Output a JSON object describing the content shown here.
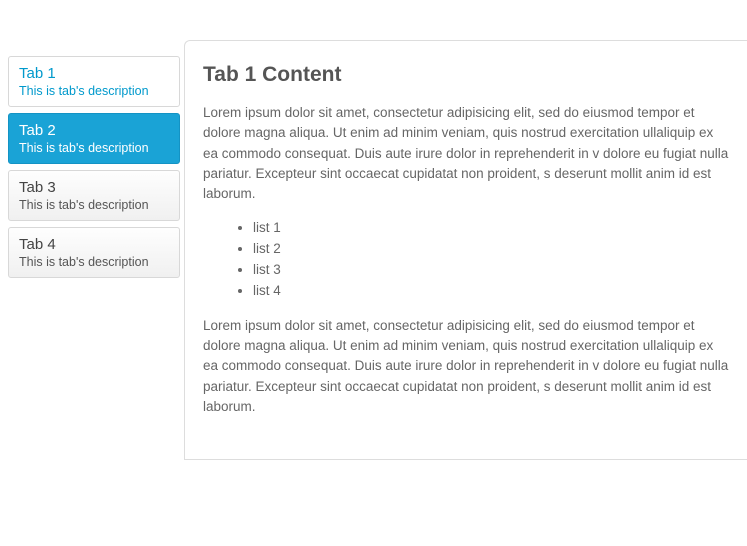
{
  "tabs": [
    {
      "title": "Tab 1",
      "desc": "This is tab's description",
      "state": "hovered"
    },
    {
      "title": "Tab 2",
      "desc": "This is tab's description",
      "state": "active"
    },
    {
      "title": "Tab 3",
      "desc": "This is tab's description",
      "state": "normal"
    },
    {
      "title": "Tab 4",
      "desc": "This is tab's description",
      "state": "normal"
    }
  ],
  "content": {
    "heading": "Tab 1 Content",
    "para1": "Lorem ipsum dolor sit amet, consectetur adipisicing elit, sed do eiusmod tempor et dolore magna aliqua. Ut enim ad minim veniam, quis nostrud exercitation ullaliquip ex ea commodo consequat. Duis aute irure dolor in reprehenderit in v dolore eu fugiat nulla pariatur. Excepteur sint occaecat cupidatat non proident, s deserunt mollit anim id est laborum.",
    "list": [
      "list 1",
      "list 2",
      "list 3",
      "list 4"
    ],
    "para2": "Lorem ipsum dolor sit amet, consectetur adipisicing elit, sed do eiusmod tempor et dolore magna aliqua. Ut enim ad minim veniam, quis nostrud exercitation ullaliquip ex ea commodo consequat. Duis aute irure dolor in reprehenderit in v dolore eu fugiat nulla pariatur. Excepteur sint occaecat cupidatat non proident, s deserunt mollit anim id est laborum."
  }
}
